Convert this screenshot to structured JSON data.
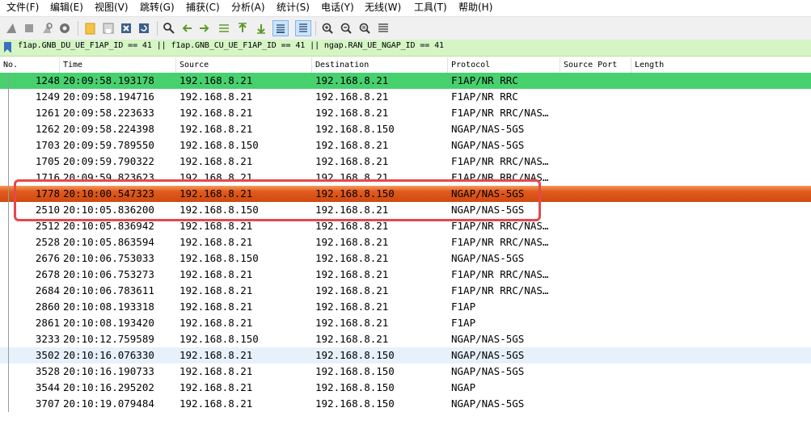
{
  "menu": [
    "文件(F)",
    "编辑(E)",
    "视图(V)",
    "跳转(G)",
    "捕获(C)",
    "分析(A)",
    "统计(S)",
    "电话(Y)",
    "无线(W)",
    "工具(T)",
    "帮助(H)"
  ],
  "toolbar_icons": [
    "shark-fin-start-icon",
    "stop-square-icon",
    "restart-fin-icon",
    "capture-options-gear-icon",
    "open-folder-icon",
    "save-file-icon",
    "close-file-icon",
    "reload-file-icon",
    "search-icon",
    "go-back-arrow-icon",
    "go-forward-arrow-icon",
    "go-to-packet-icon",
    "go-first-packet-icon",
    "go-last-packet-icon",
    "autoscroll-icon",
    "colorize-lines-icon",
    "zoom-in-icon",
    "zoom-out-icon",
    "zoom-normal-icon",
    "resize-columns-icon"
  ],
  "filter": {
    "text": "f1ap.GNB_DU_UE_F1AP_ID == 41 || f1ap.GNB_CU_UE_F1AP_ID == 41 || ngap.RAN_UE_NGAP_ID == 41"
  },
  "columns": {
    "no": "No.",
    "time": "Time",
    "source": "Source",
    "destination": "Destination",
    "protocol": "Protocol",
    "source_port": "Source Port",
    "length": "Length"
  },
  "colors": {
    "selected_green": "#46d16e",
    "highlight_orange": "#e25a1c",
    "light_blue": "#e6f1fb",
    "annotation_red": "#e5484d",
    "filter_bg": "#d5f5c5"
  },
  "packets": [
    {
      "no": "1248",
      "time": "20:09:58.193178",
      "src": "192.168.8.21",
      "dst": "192.168.8.21",
      "proto": "F1AP/NR RRC",
      "style": "green"
    },
    {
      "no": "1249",
      "time": "20:09:58.194716",
      "src": "192.168.8.21",
      "dst": "192.168.8.21",
      "proto": "F1AP/NR RRC",
      "style": "normal"
    },
    {
      "no": "1261",
      "time": "20:09:58.223633",
      "src": "192.168.8.21",
      "dst": "192.168.8.21",
      "proto": "F1AP/NR RRC/NAS…",
      "style": "normal"
    },
    {
      "no": "1262",
      "time": "20:09:58.224398",
      "src": "192.168.8.21",
      "dst": "192.168.8.150",
      "proto": "NGAP/NAS-5GS",
      "style": "normal"
    },
    {
      "no": "1703",
      "time": "20:09:59.789550",
      "src": "192.168.8.150",
      "dst": "192.168.8.21",
      "proto": "NGAP/NAS-5GS",
      "style": "normal"
    },
    {
      "no": "1705",
      "time": "20:09:59.790322",
      "src": "192.168.8.21",
      "dst": "192.168.8.21",
      "proto": "F1AP/NR RRC/NAS…",
      "style": "normal"
    },
    {
      "no": "1716",
      "time": "20:09:59.823623",
      "src": "192.168.8.21",
      "dst": "192.168.8.21",
      "proto": "F1AP/NR RRC/NAS…",
      "style": "normal"
    },
    {
      "no": "1778",
      "time": "20:10:00.547323",
      "src": "192.168.8.21",
      "dst": "192.168.8.150",
      "proto": "NGAP/NAS-5GS",
      "style": "orange"
    },
    {
      "no": "2510",
      "time": "20:10:05.836200",
      "src": "192.168.8.150",
      "dst": "192.168.8.21",
      "proto": "NGAP/NAS-5GS",
      "style": "normal"
    },
    {
      "no": "2512",
      "time": "20:10:05.836942",
      "src": "192.168.8.21",
      "dst": "192.168.8.21",
      "proto": "F1AP/NR RRC/NAS…",
      "style": "normal"
    },
    {
      "no": "2528",
      "time": "20:10:05.863594",
      "src": "192.168.8.21",
      "dst": "192.168.8.21",
      "proto": "F1AP/NR RRC/NAS…",
      "style": "normal"
    },
    {
      "no": "2676",
      "time": "20:10:06.753033",
      "src": "192.168.8.150",
      "dst": "192.168.8.21",
      "proto": "NGAP/NAS-5GS",
      "style": "normal"
    },
    {
      "no": "2678",
      "time": "20:10:06.753273",
      "src": "192.168.8.21",
      "dst": "192.168.8.21",
      "proto": "F1AP/NR RRC/NAS…",
      "style": "normal"
    },
    {
      "no": "2684",
      "time": "20:10:06.783611",
      "src": "192.168.8.21",
      "dst": "192.168.8.21",
      "proto": "F1AP/NR RRC/NAS…",
      "style": "normal"
    },
    {
      "no": "2860",
      "time": "20:10:08.193318",
      "src": "192.168.8.21",
      "dst": "192.168.8.21",
      "proto": "F1AP",
      "style": "normal"
    },
    {
      "no": "2861",
      "time": "20:10:08.193420",
      "src": "192.168.8.21",
      "dst": "192.168.8.21",
      "proto": "F1AP",
      "style": "normal"
    },
    {
      "no": "3233",
      "time": "20:10:12.759589",
      "src": "192.168.8.150",
      "dst": "192.168.8.21",
      "proto": "NGAP/NAS-5GS",
      "style": "normal"
    },
    {
      "no": "3502",
      "time": "20:10:16.076330",
      "src": "192.168.8.21",
      "dst": "192.168.8.150",
      "proto": "NGAP/NAS-5GS",
      "style": "blue"
    },
    {
      "no": "3528",
      "time": "20:10:16.190733",
      "src": "192.168.8.21",
      "dst": "192.168.8.150",
      "proto": "NGAP/NAS-5GS",
      "style": "normal"
    },
    {
      "no": "3544",
      "time": "20:10:16.295202",
      "src": "192.168.8.21",
      "dst": "192.168.8.150",
      "proto": "NGAP",
      "style": "normal"
    },
    {
      "no": "3707",
      "time": "20:10:19.079484",
      "src": "192.168.8.21",
      "dst": "192.168.8.150",
      "proto": "NGAP/NAS-5GS",
      "style": "normal"
    }
  ]
}
